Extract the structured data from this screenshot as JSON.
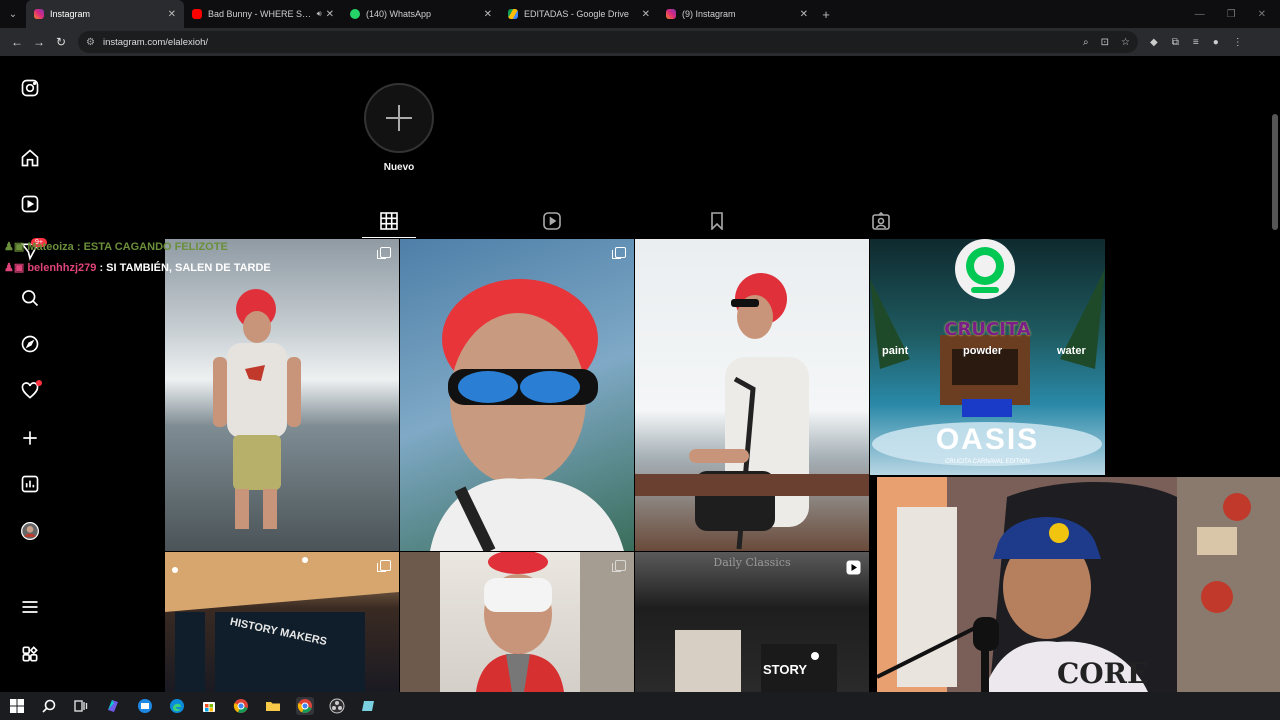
{
  "browser": {
    "tabs": [
      {
        "label": "Instagram",
        "active": true,
        "icon": "instagram-icon",
        "color": "#d6249f"
      },
      {
        "label": "Bad Bunny - WHERE SHE G",
        "active": false,
        "icon": "youtube-icon",
        "color": "#ff0000",
        "audio": true
      },
      {
        "label": "(140) WhatsApp",
        "active": false,
        "icon": "whatsapp-icon",
        "color": "#25d366"
      },
      {
        "label": "EDITADAS - Google Drive",
        "active": false,
        "icon": "google-drive-icon",
        "color": "#fbbc04"
      },
      {
        "label": "(9) Instagram",
        "active": false,
        "icon": "instagram-icon",
        "color": "#d6249f"
      }
    ],
    "url": "instagram.com/elalexioh/"
  },
  "instagram": {
    "new_highlight_label": "Nuevo",
    "notification_badge": "9+",
    "profile_tabs": [
      "posts-grid",
      "reels",
      "saved",
      "tagged"
    ],
    "grid_cells": [
      {
        "type": "carousel",
        "description_icon": "multi-post-icon"
      },
      {
        "type": "carousel",
        "description_icon": "multi-post-icon"
      },
      {
        "type": "single"
      },
      {
        "type": "single",
        "overlay_text": {
          "brand": "CRUCITA",
          "left": "paint",
          "center": "powder",
          "right": "water",
          "event": "OASIS",
          "edition": "CRUCITA CARNAVAL EDITION"
        }
      },
      {
        "type": "carousel",
        "sign": "HISTORY MAKERS"
      },
      {
        "type": "carousel"
      },
      {
        "type": "reel",
        "sign": "Daily Classics",
        "sticker": "STORY"
      }
    ]
  },
  "chat": [
    {
      "user": "Mateoiza",
      "message": "ESTA CAGANDO FELIZOTE"
    },
    {
      "user": "belenhhzj279",
      "message": "SI TAMBIÉN, SALEN DE TARDE"
    }
  ],
  "webcam": {
    "shirt_text": "CORE"
  },
  "taskbar": [
    "windows-start-icon",
    "search-icon",
    "task-view-icon",
    "copilot-icon",
    "edge-mail-icon",
    "edge-icon",
    "store-icon",
    "chrome-icon",
    "file-explorer-icon",
    "chrome-active-icon",
    "obs-icon",
    "app-icon"
  ]
}
